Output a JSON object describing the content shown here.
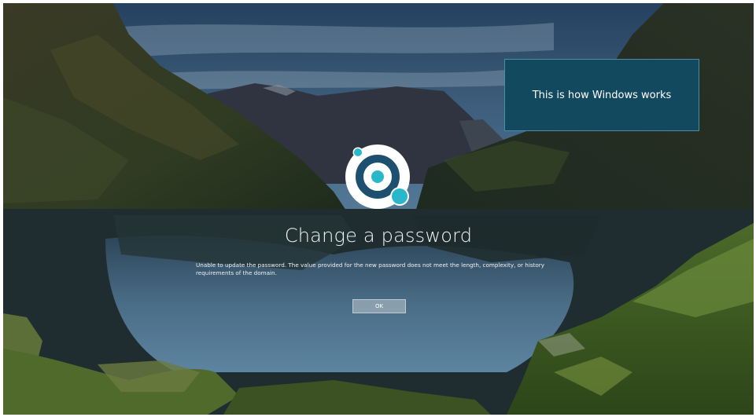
{
  "callout": {
    "text": "This is how Windows works"
  },
  "dialog": {
    "title": "Change a password",
    "message": "Unable to update the password. The value provided for the new password does not meet the length, complexity, or history requirements of the domain.",
    "ok_label": "OK"
  },
  "logo": {
    "icon": "target-orbit-logo-icon",
    "colors": {
      "circle_bg": "#ffffff",
      "ring": "#1d4f6e",
      "accent": "#2ab7c9"
    }
  },
  "colors": {
    "callout_bg": "#13495e",
    "button_bg": "#9aa6ad"
  }
}
